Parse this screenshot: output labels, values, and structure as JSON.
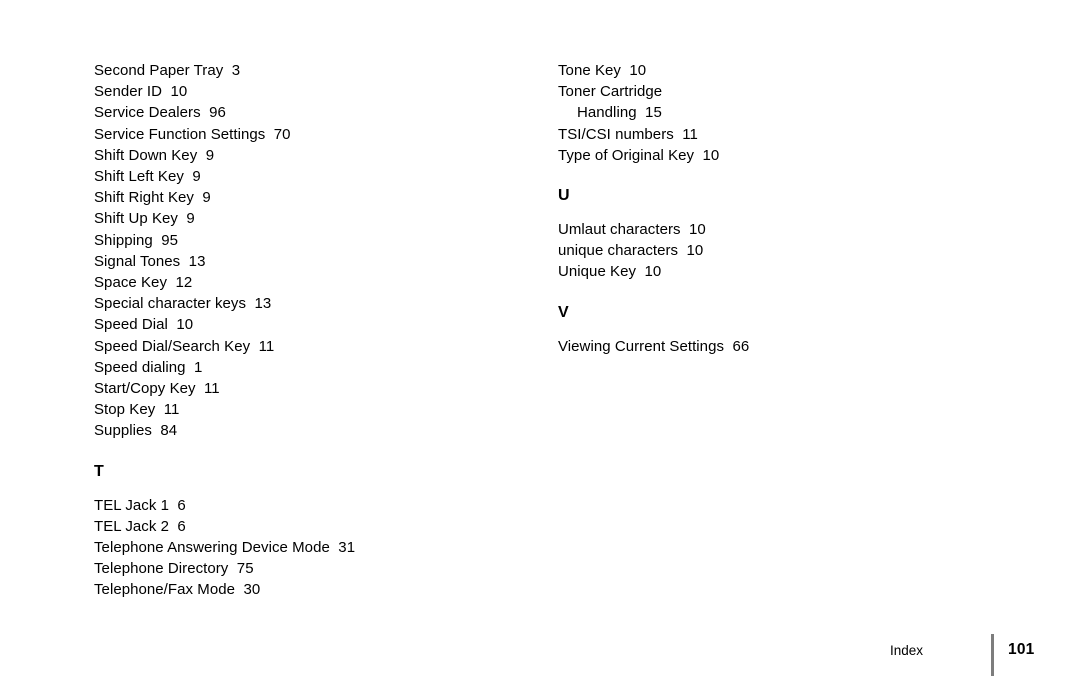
{
  "document": {
    "footer": {
      "label": "Index",
      "page_number": "101",
      "rule_color": "#7d7d7d"
    }
  },
  "columns": {
    "left": {
      "blocks": [
        {
          "type": "entries",
          "items": [
            {
              "label": "Second Paper Tray",
              "page": "3"
            },
            {
              "label": "Sender ID",
              "page": "10"
            },
            {
              "label": "Service Dealers",
              "page": "96"
            },
            {
              "label": "Service Function Settings",
              "page": "70"
            },
            {
              "label": "Shift Down Key",
              "page": "9"
            },
            {
              "label": "Shift Left Key",
              "page": "9"
            },
            {
              "label": "Shift Right Key",
              "page": "9"
            },
            {
              "label": "Shift Up Key",
              "page": "9"
            },
            {
              "label": "Shipping",
              "page": "95"
            },
            {
              "label": "Signal Tones",
              "page": "13"
            },
            {
              "label": "Space Key",
              "page": "12"
            },
            {
              "label": "Special character keys",
              "page": "13"
            },
            {
              "label": "Speed Dial",
              "page": "10"
            },
            {
              "label": "Speed Dial/Search Key",
              "page": "11"
            },
            {
              "label": "Speed dialing",
              "page": "1"
            },
            {
              "label": "Start/Copy Key",
              "page": "11"
            },
            {
              "label": "Stop Key",
              "page": "11"
            },
            {
              "label": "Supplies",
              "page": "84"
            }
          ]
        },
        {
          "type": "heading",
          "letter": "T"
        },
        {
          "type": "entries",
          "items": [
            {
              "label": "TEL Jack 1",
              "page": "6"
            },
            {
              "label": "TEL Jack 2",
              "page": "6"
            },
            {
              "label": "Telephone Answering Device Mode",
              "page": "31"
            },
            {
              "label": "Telephone Directory",
              "page": "75"
            },
            {
              "label": "Telephone/Fax Mode",
              "page": "30"
            }
          ]
        }
      ]
    },
    "right": {
      "blocks": [
        {
          "type": "entries",
          "items": [
            {
              "label": "Tone Key",
              "page": "10"
            },
            {
              "label": "Toner Cartridge",
              "page": ""
            },
            {
              "label": "Handling",
              "page": "15",
              "sub": true
            },
            {
              "label": "TSI/CSI numbers",
              "page": "11"
            },
            {
              "label": "Type of Original Key",
              "page": "10"
            }
          ]
        },
        {
          "type": "heading",
          "letter": "U"
        },
        {
          "type": "entries",
          "items": [
            {
              "label": "Umlaut characters",
              "page": "10"
            },
            {
              "label": "unique characters",
              "page": "10"
            },
            {
              "label": "Unique Key",
              "page": "10"
            }
          ]
        },
        {
          "type": "heading",
          "letter": "V"
        },
        {
          "type": "entries",
          "items": [
            {
              "label": "Viewing Current Settings",
              "page": "66"
            }
          ]
        }
      ]
    }
  }
}
